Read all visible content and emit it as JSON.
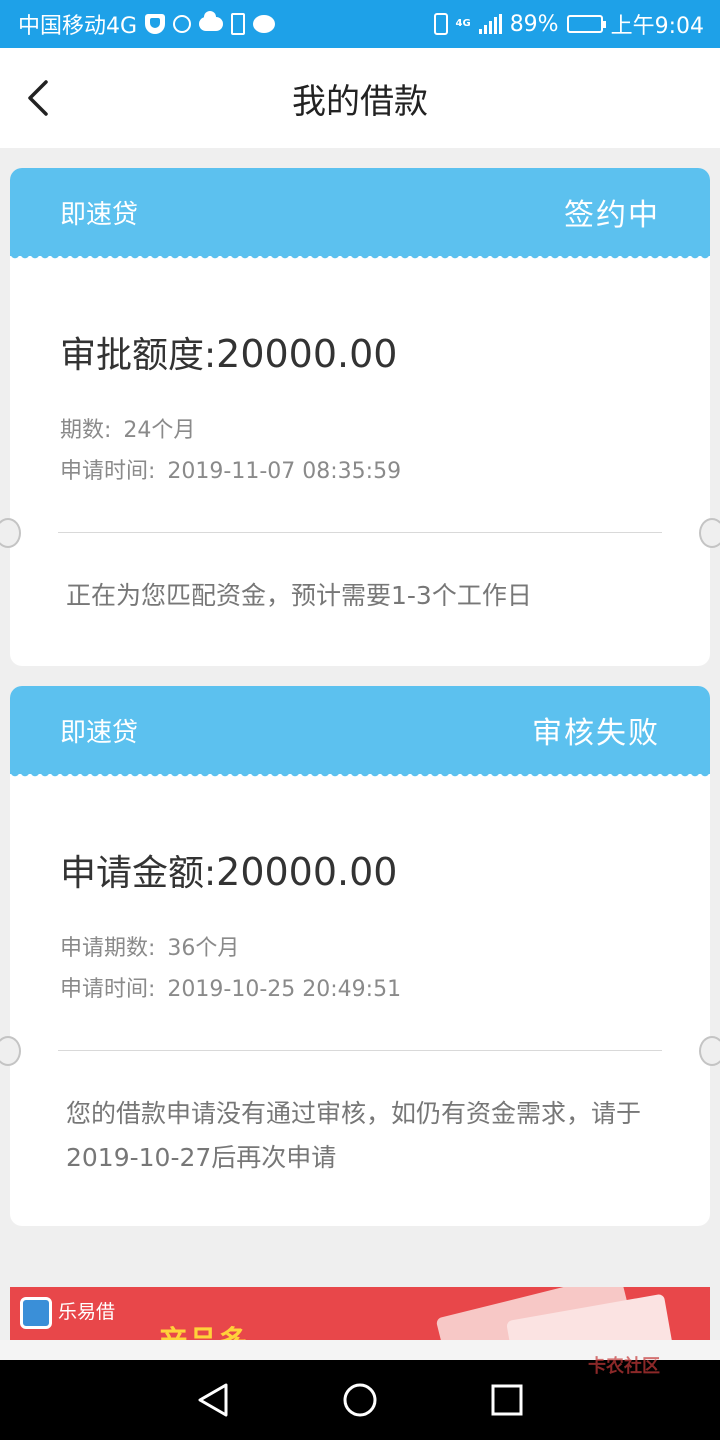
{
  "status_bar": {
    "carrier": "中国移动4G",
    "net_type": "4G",
    "battery": "89%",
    "battery_level": 0.89,
    "time": "上午9:04"
  },
  "nav": {
    "title": "我的借款"
  },
  "loans": [
    {
      "product": "即速贷",
      "status": "签约中",
      "amount_label": "审批额度:",
      "amount": "20000.00",
      "meta": [
        {
          "label": "期数:",
          "value": "24个月"
        },
        {
          "label": "申请时间:",
          "value": "2019-11-07 08:35:59"
        }
      ],
      "note": "正在为您匹配资金，预计需要1-3个工作日"
    },
    {
      "product": "即速贷",
      "status": "审核失败",
      "amount_label": "申请金额:",
      "amount": "20000.00",
      "meta": [
        {
          "label": "申请期数:",
          "value": "36个月"
        },
        {
          "label": "申请时间:",
          "value": "2019-10-25 20:49:51"
        }
      ],
      "note": "您的借款申请没有通过审核，如仍有资金需求，请于2019-10-27后再次申请"
    }
  ],
  "banner": {
    "name": "乐易借",
    "slogan": "产品多"
  },
  "watermark": "卡农社区",
  "colors": {
    "status_bar": "#1ea1e8",
    "card_header": "#5cc1ef",
    "banner": "#e8474a"
  }
}
